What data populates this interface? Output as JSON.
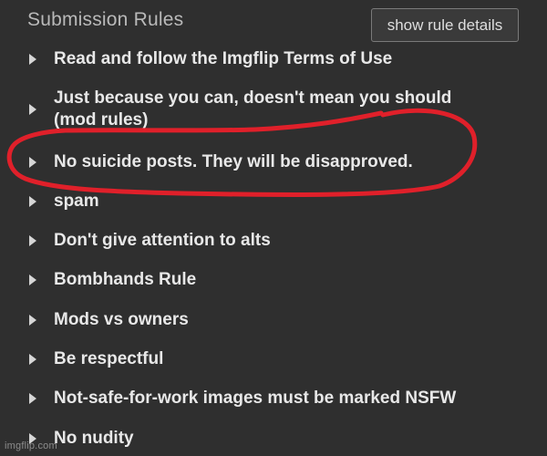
{
  "header": {
    "title": "Submission Rules",
    "details_button": "show rule details"
  },
  "rules": [
    {
      "line1": "Read and follow the Imgflip Terms of Use",
      "line2": ""
    },
    {
      "line1": "Just because you can, doesn't mean you should",
      "line2": "(mod rules)"
    },
    {
      "line1": "No suicide posts. They will be disapproved.",
      "line2": ""
    },
    {
      "line1": "spam",
      "line2": ""
    },
    {
      "line1": "Don't give attention to alts",
      "line2": ""
    },
    {
      "line1": "Bombhands Rule",
      "line2": ""
    },
    {
      "line1": "Mods vs owners",
      "line2": ""
    },
    {
      "line1": "Be respectful",
      "line2": ""
    },
    {
      "line1": "Not-safe-for-work images must be marked NSFW",
      "line2": ""
    },
    {
      "line1": "No nudity",
      "line2": ""
    }
  ],
  "annotation": {
    "color": "#e0202a",
    "target": "No suicide posts. They will be disapproved."
  },
  "watermark": "imgflip.com",
  "colors": {
    "background": "#2f2f2f",
    "title_text": "#b9b9b9",
    "rule_text": "#e8e8e8",
    "button_border": "#7a7a7a"
  }
}
